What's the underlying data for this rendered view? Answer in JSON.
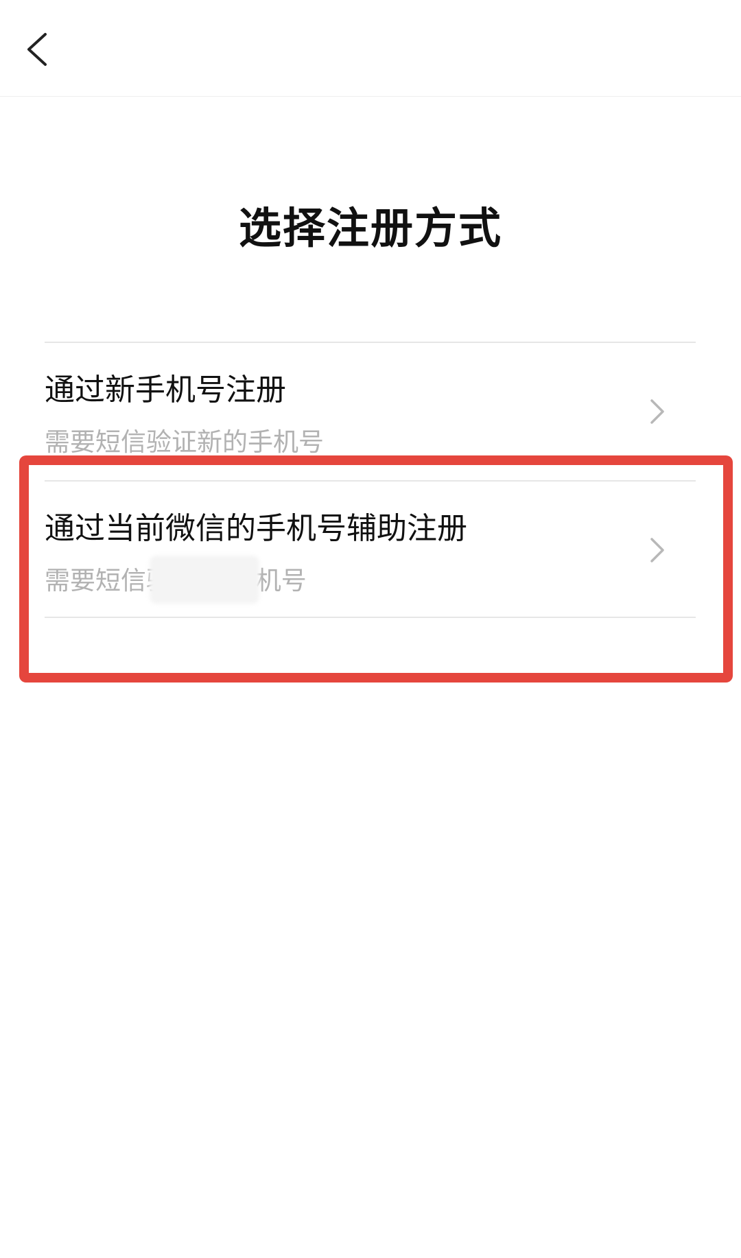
{
  "header": {
    "back_icon": "chevron-left-icon"
  },
  "page": {
    "title": "选择注册方式"
  },
  "options": [
    {
      "title": "通过新手机号注册",
      "description": "需要短信验证新的手机号",
      "icon": "chevron-right-icon"
    },
    {
      "title": "通过当前微信的手机号辅助注册",
      "description": "需要短信验证 的手机号",
      "icon": "chevron-right-icon"
    }
  ],
  "colors": {
    "background": "#ffffff",
    "title_text": "#111111",
    "secondary_text": "#b2b2b2",
    "divider": "#e6e6e6",
    "highlight_border": "#e5463d"
  }
}
